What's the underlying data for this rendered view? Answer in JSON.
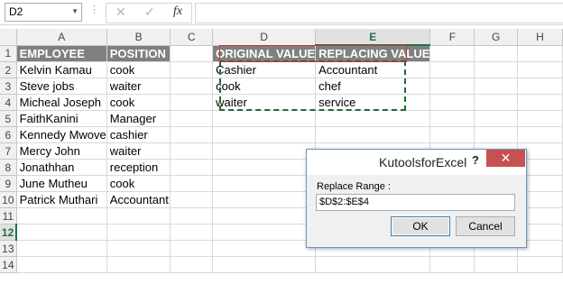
{
  "formula_bar": {
    "name_box": "D2",
    "name_box_arrow": "▼",
    "dots": "⋮",
    "cancel_symbol": "✕",
    "enter_symbol": "✓",
    "fx_label": "fx",
    "formula": ""
  },
  "columns": [
    "A",
    "B",
    "C",
    "D",
    "E",
    "F",
    "G",
    "H"
  ],
  "rows": [
    [
      "EMPLOYEE",
      "POSITION",
      "",
      "ORIGINAL VALUE",
      "REPLACING VALUE",
      "",
      "",
      ""
    ],
    [
      "Kelvin Kamau",
      "cook",
      "",
      "Cashier",
      "Accountant",
      "",
      "",
      ""
    ],
    [
      "Steve jobs",
      "waiter",
      "",
      "cook",
      "chef",
      "",
      "",
      ""
    ],
    [
      "Micheal Joseph",
      "cook",
      "",
      "waiter",
      "service",
      "",
      "",
      ""
    ],
    [
      "FaithKanini",
      "Manager",
      "",
      "",
      "",
      "",
      "",
      ""
    ],
    [
      "Kennedy Mwove",
      "cashier",
      "",
      "",
      "",
      "",
      "",
      ""
    ],
    [
      "Mercy John",
      "waiter",
      "",
      "",
      "",
      "",
      "",
      ""
    ],
    [
      "Jonathhan",
      "reception",
      "",
      "",
      "",
      "",
      "",
      ""
    ],
    [
      "June Mutheu",
      "cook",
      "",
      "",
      "",
      "",
      "",
      ""
    ],
    [
      "Patrick Muthari",
      "Accountant",
      "",
      "",
      "",
      "",
      "",
      ""
    ],
    [
      "",
      "",
      "",
      "",
      "",
      "",
      "",
      ""
    ],
    [
      "",
      "",
      "",
      "",
      "",
      "",
      "",
      ""
    ],
    [
      "",
      "",
      "",
      "",
      "",
      "",
      "",
      ""
    ],
    [
      "",
      "",
      "",
      "",
      "",
      "",
      "",
      ""
    ]
  ],
  "row_numbers": [
    "1",
    "2",
    "3",
    "4",
    "5",
    "6",
    "7",
    "8",
    "9",
    "10",
    "11",
    "12",
    "13",
    "14"
  ],
  "active_column": "E",
  "active_row": "12",
  "colors": {
    "header_fill": "#808080",
    "accent_green": "#217346",
    "marching_ants": "#1e6b34",
    "selection_red": "#cc3333",
    "close_red": "#c75050"
  },
  "dialog": {
    "title": "KutoolsforExcel",
    "help": "?",
    "close": "✕",
    "label": "Replace Range :",
    "range_value": "$D$2:$E$4",
    "ok_label": "OK",
    "cancel_label": "Cancel"
  }
}
